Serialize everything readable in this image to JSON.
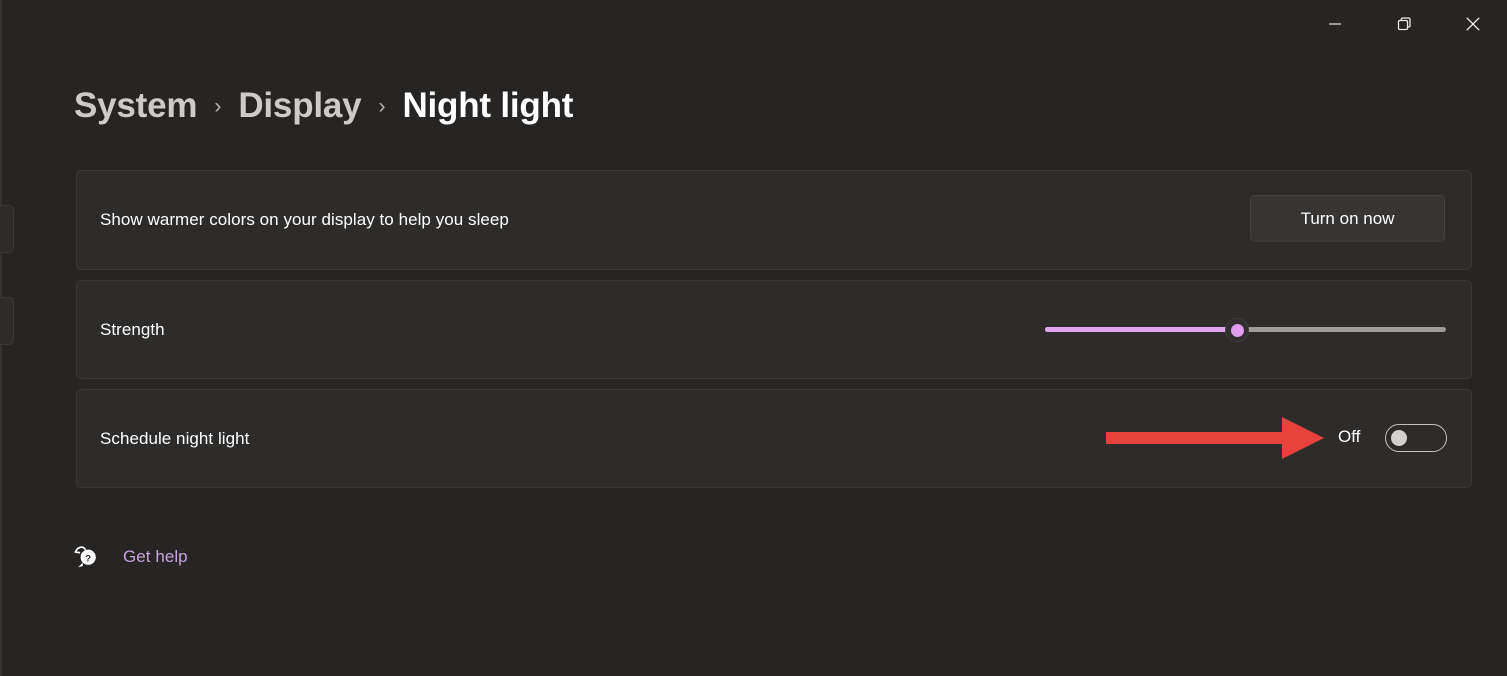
{
  "window": {
    "controls": [
      {
        "name": "minimize",
        "icon": "minimize-icon",
        "tooltip": "Minimize"
      },
      {
        "name": "restore",
        "icon": "restore-icon",
        "tooltip": "Restore Down"
      },
      {
        "name": "close",
        "icon": "close-icon",
        "tooltip": "Close"
      }
    ]
  },
  "breadcrumb": {
    "items": [
      {
        "label": "System",
        "current": false
      },
      {
        "label": "Display",
        "current": false
      },
      {
        "label": "Night light",
        "current": true
      }
    ],
    "separator": "›"
  },
  "settings": {
    "cards": [
      {
        "label": "Show warmer colors on your display to help you sleep",
        "control": "button",
        "button_label": "Turn on now"
      },
      {
        "label": "Strength",
        "control": "slider",
        "slider_value": 48,
        "slider_min": 0,
        "slider_max": 100
      },
      {
        "label": "Schedule night light",
        "control": "toggle",
        "toggle_state": "Off",
        "toggle_on": false
      }
    ]
  },
  "annotation": {
    "type": "arrow",
    "direction": "right",
    "color": "#e8423c",
    "points_to": "Schedule night light toggle"
  },
  "footer": {
    "help_icon": "question-bubble-icon",
    "help_label": "Get help"
  },
  "colors": {
    "page_background": "#262524",
    "card_background": "#2d2c2b",
    "card_border": "#393837",
    "accent_slider": "#e0a5ef",
    "link": "#c8a2dd",
    "annotation_red": "#e8423c",
    "text_primary": "#ffffff",
    "text_secondary": "#cdcbc9"
  }
}
